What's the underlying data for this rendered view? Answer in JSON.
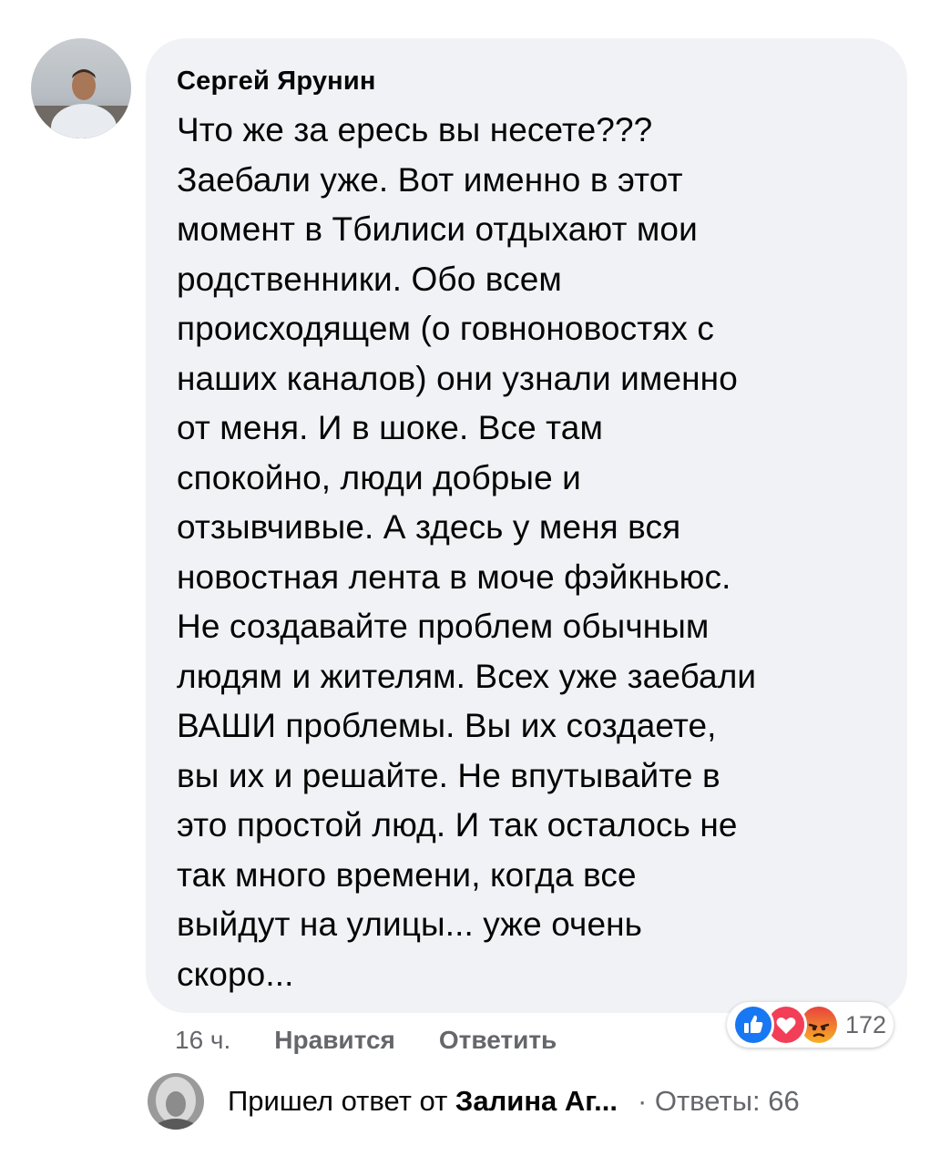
{
  "comment": {
    "author": "Сергей Ярунин",
    "lines": [
      "Что же за ересь вы несете???",
      "Заебали уже. Вот именно в этот",
      "момент в Тбилиси отдыхают мои",
      "родственники. Обо всем",
      "происходящем (о говноновостях с",
      "наших каналов) они узнали именно",
      "от меня. И в шоке. Все там",
      "спокойно, люди добрые и",
      "отзывчивые. А здесь у меня вся",
      "новостная лента в моче фэйкньюс.",
      "Не создавайте проблем обычным",
      "людям и жителям. Всех уже заебали",
      "ВАШИ проблемы. Вы их создаете,",
      "вы их и решайте. Не впутывайте в",
      "это простой люд. И так осталось не",
      "так много времени, когда все",
      "выйдут на улицы... уже очень",
      "скоро..."
    ]
  },
  "actions": {
    "time": "16 ч.",
    "like": "Нравится",
    "reply": "Ответить"
  },
  "reactions": {
    "icons": [
      "like-icon",
      "love-icon",
      "angry-icon"
    ],
    "colors": {
      "like": "#1877f2",
      "love": "#f33e58",
      "angry": "#f0703a"
    },
    "count": "172"
  },
  "replies": {
    "prefix": "Пришел ответ от",
    "name": "Залина Аг...",
    "count_label": "· Ответы: 66"
  }
}
